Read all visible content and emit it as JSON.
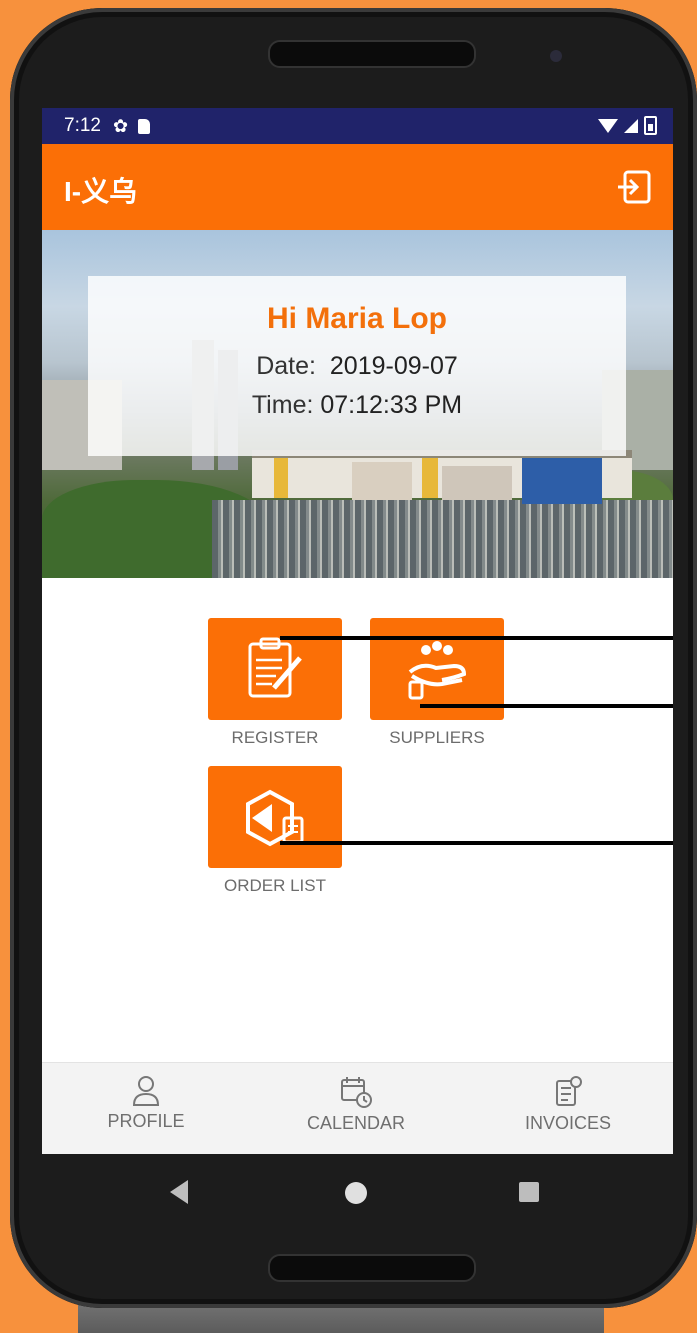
{
  "status_bar": {
    "time": "7:12"
  },
  "app_bar": {
    "title": "I-义乌",
    "exit_icon": "exit-icon"
  },
  "greeting_card": {
    "greeting": "Hi Maria Lop",
    "date_label": "Date:",
    "date_value": "2019-09-07",
    "time_label": "Time:",
    "time_value": "07:12:33 PM"
  },
  "tiles": {
    "register": {
      "label": "REGISTER",
      "icon": "clipboard-pen-icon"
    },
    "suppliers": {
      "label": "SUPPLIERS",
      "icon": "handshake-icon"
    },
    "order_list": {
      "label": "ORDER LIST",
      "icon": "package-return-icon"
    }
  },
  "bottom_nav": {
    "profile": {
      "label": "PROFILE",
      "icon": "user-icon"
    },
    "calendar": {
      "label": "CALENDAR",
      "icon": "calendar-clock-icon"
    },
    "invoices": {
      "label": "INVOICES",
      "icon": "invoice-icon"
    }
  },
  "colors": {
    "accent": "#fb6f06",
    "status_bar": "#20236a",
    "frame_bg": "#f7913d"
  }
}
